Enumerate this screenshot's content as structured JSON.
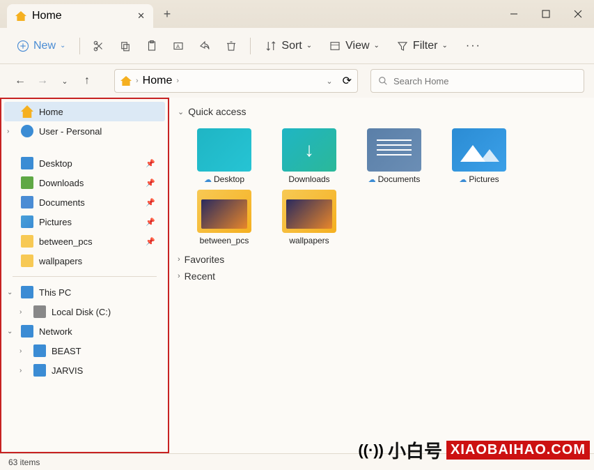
{
  "titlebar": {
    "tab_title": "Home"
  },
  "toolbar": {
    "new": "New",
    "sort": "Sort",
    "view": "View",
    "filter": "Filter"
  },
  "crumb": {
    "location": "Home"
  },
  "search": {
    "placeholder": "Search Home"
  },
  "sidebar": {
    "home": "Home",
    "user": "User - Personal",
    "desktop": "Desktop",
    "downloads": "Downloads",
    "documents": "Documents",
    "pictures": "Pictures",
    "between": "between_pcs",
    "wallpapers": "wallpapers",
    "thispc": "This PC",
    "localdisk": "Local Disk (C:)",
    "network": "Network",
    "beast": "BEAST",
    "jarvis": "JARVIS"
  },
  "content": {
    "quick_access": "Quick access",
    "favorites": "Favorites",
    "recent": "Recent",
    "items": {
      "desktop": "Desktop",
      "downloads": "Downloads",
      "documents": "Documents",
      "pictures": "Pictures",
      "between": "between_pcs",
      "wallpapers": "wallpapers"
    }
  },
  "status": {
    "count": "63 items"
  },
  "watermark": {
    "cn": "小白号",
    "url": "XIAOBAIHAO.COM"
  }
}
